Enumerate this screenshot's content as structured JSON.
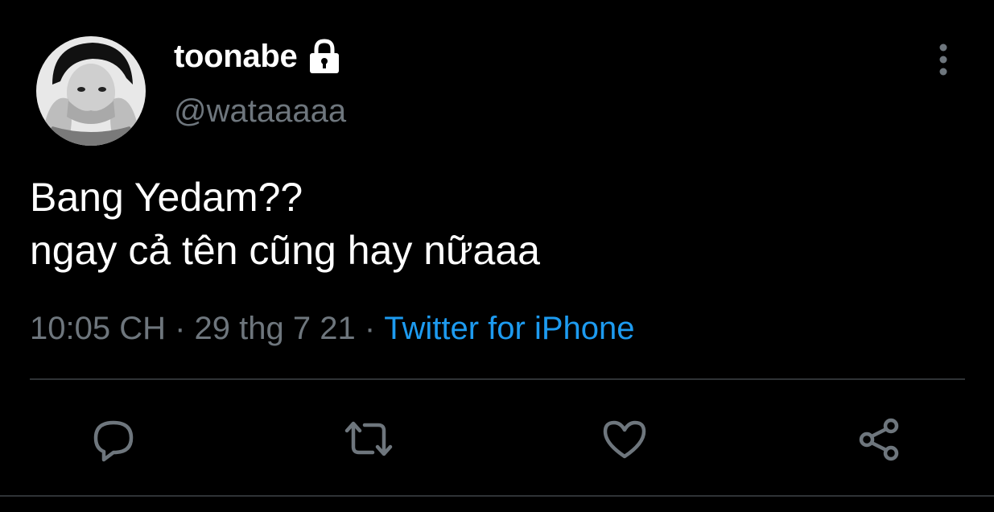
{
  "user": {
    "display_name": "toonabe",
    "handle": "@wataaaaa",
    "avatar_icon": "profile-photo",
    "protected_icon": "lock-icon"
  },
  "tweet": {
    "text": "Bang Yedam??\nngay cả tên cũng hay nữaaa",
    "time": "10:05 CH",
    "separator": " · ",
    "date": "29 thg 7 21",
    "source": "Twitter for iPhone"
  },
  "actions": [
    {
      "name": "reply",
      "icon": "reply-icon"
    },
    {
      "name": "retweet",
      "icon": "retweet-icon"
    },
    {
      "name": "like",
      "icon": "heart-icon"
    },
    {
      "name": "share",
      "icon": "share-icon"
    }
  ],
  "colors": {
    "background": "#000000",
    "text_primary": "#ffffff",
    "text_secondary": "#6e767d",
    "accent": "#1d9bf0",
    "divider": "#2f3336"
  }
}
